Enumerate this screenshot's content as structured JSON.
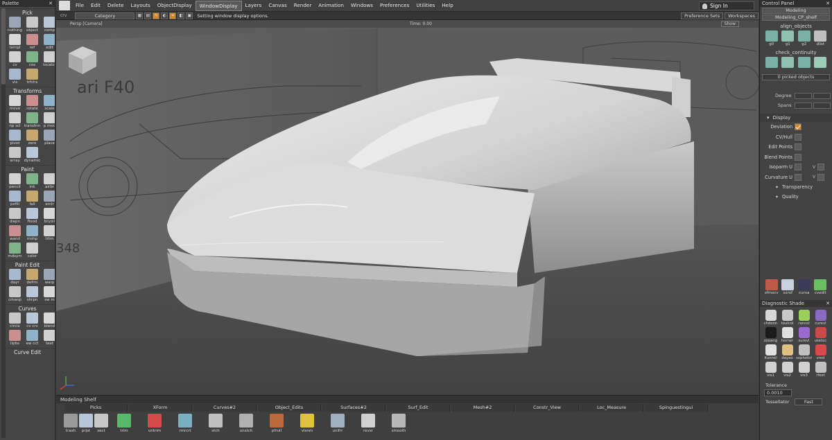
{
  "palette": {
    "title": "Palette",
    "sections": [
      {
        "name": "Pick",
        "tools": [
          "nothing",
          "object",
          "comp",
          "templ",
          "ref",
          "edit",
          "cv",
          "cos",
          "locator",
          "vis",
          "trfchs"
        ]
      },
      {
        "name": "Transforms",
        "tools": [
          "move",
          "rotate",
          "scale",
          "np scl",
          "transfrm",
          "p mod",
          "pivot",
          "zero",
          "place",
          "array",
          "dynamic"
        ]
      },
      {
        "name": "Paint",
        "tools": [
          "pencil",
          "ink",
          "airbr",
          "psfill",
          "fall",
          "erclr",
          "dwpn",
          "flood",
          "bryoil",
          "wand",
          "mshp",
          "trtrn",
          "mdsym",
          "color"
        ]
      },
      {
        "name": "Paint Edit",
        "tools": [
          "dayr",
          "defrm",
          "warp",
          "cmanp",
          "shrpn",
          "sw m"
        ]
      },
      {
        "name": "Curves",
        "tools": [
          "circle",
          "cv crv",
          "blend",
          "lipbs",
          "ew cct",
          "text"
        ]
      },
      {
        "name": "Curve Edit",
        "tools": []
      }
    ]
  },
  "menubar": {
    "items": [
      "File",
      "Edit",
      "Delete",
      "Layouts",
      "ObjectDisplay",
      "WindowDisplay",
      "Layers",
      "Canvas",
      "Render",
      "Animation",
      "Windows",
      "Preferences",
      "Utilities",
      "Help"
    ],
    "active": "WindowDisplay",
    "signin": "Sign In"
  },
  "toolbar": {
    "crv_label": "crv",
    "category": "Category",
    "status": "Setting window display options.",
    "pref_sets": "Preference Sets",
    "workspaces": "Workspaces",
    "modeling": "Modeling"
  },
  "viewport": {
    "camera": "Persp [Camera]",
    "time": "Time: 0.00",
    "show": "Show"
  },
  "shelf": {
    "title": "Modeling Shelf",
    "tabs": [
      "Picks",
      "XForm",
      "Curves#2",
      "Object_Edits",
      "Surfaces#2",
      "Surf_Edit",
      "Mesh#2",
      "Constr_View",
      "Loc_Measure",
      "Spinguestingui"
    ],
    "tools": [
      "trash",
      "prjst",
      "sect",
      "trim",
      "untrim",
      "rmrcrt",
      "stch",
      "unstch",
      "pfrull",
      "visnm",
      "unifrr",
      "revsr",
      "smooth"
    ]
  },
  "control_panel": {
    "title": "Control Panel",
    "workspace": "Modeling",
    "shelf_name": "Modeling_CP_shelf",
    "align_title": "align_objects",
    "align_tools": [
      "g0",
      "g1",
      "g2",
      "dlist"
    ],
    "continuity_title": "check_continuity",
    "picked": "0 picked objects",
    "degree_label": "Degree",
    "spans_label": "Spans",
    "display_label": "Display",
    "display_options": [
      {
        "label": "Deviation",
        "checked": true
      },
      {
        "label": "CV/Hull",
        "checked": false
      },
      {
        "label": "Edit Points",
        "checked": false
      },
      {
        "label": "Blend Points",
        "checked": false
      },
      {
        "label": "Isoparm U",
        "checked": false,
        "v": "V"
      },
      {
        "label": "Curvature U",
        "checked": false,
        "v": "V"
      }
    ],
    "sub_options": [
      "Transparency",
      "Quality"
    ],
    "bottom_tools": [
      "sfmocv",
      "sxrof",
      "curva",
      "cvedit"
    ],
    "diag_title": "Diagnostic Shade",
    "diag_tools": [
      "chdonn",
      "toulcol",
      "rancol",
      "curevl",
      "zooang",
      "horrwr",
      "surevl",
      "usetec",
      "ltunnel",
      "dayao",
      "sophotol",
      "vred",
      "vis1",
      "vis2",
      "vis3",
      "rfest"
    ],
    "tolerance_label": "Tolerance",
    "tolerance_value": "0.0010",
    "tessellator_label": "Tessellator",
    "tessellator_value": "Fast"
  },
  "colors": {
    "accent": "#d6862a",
    "panel": "#434343",
    "viewport": "#5b5b5b"
  }
}
